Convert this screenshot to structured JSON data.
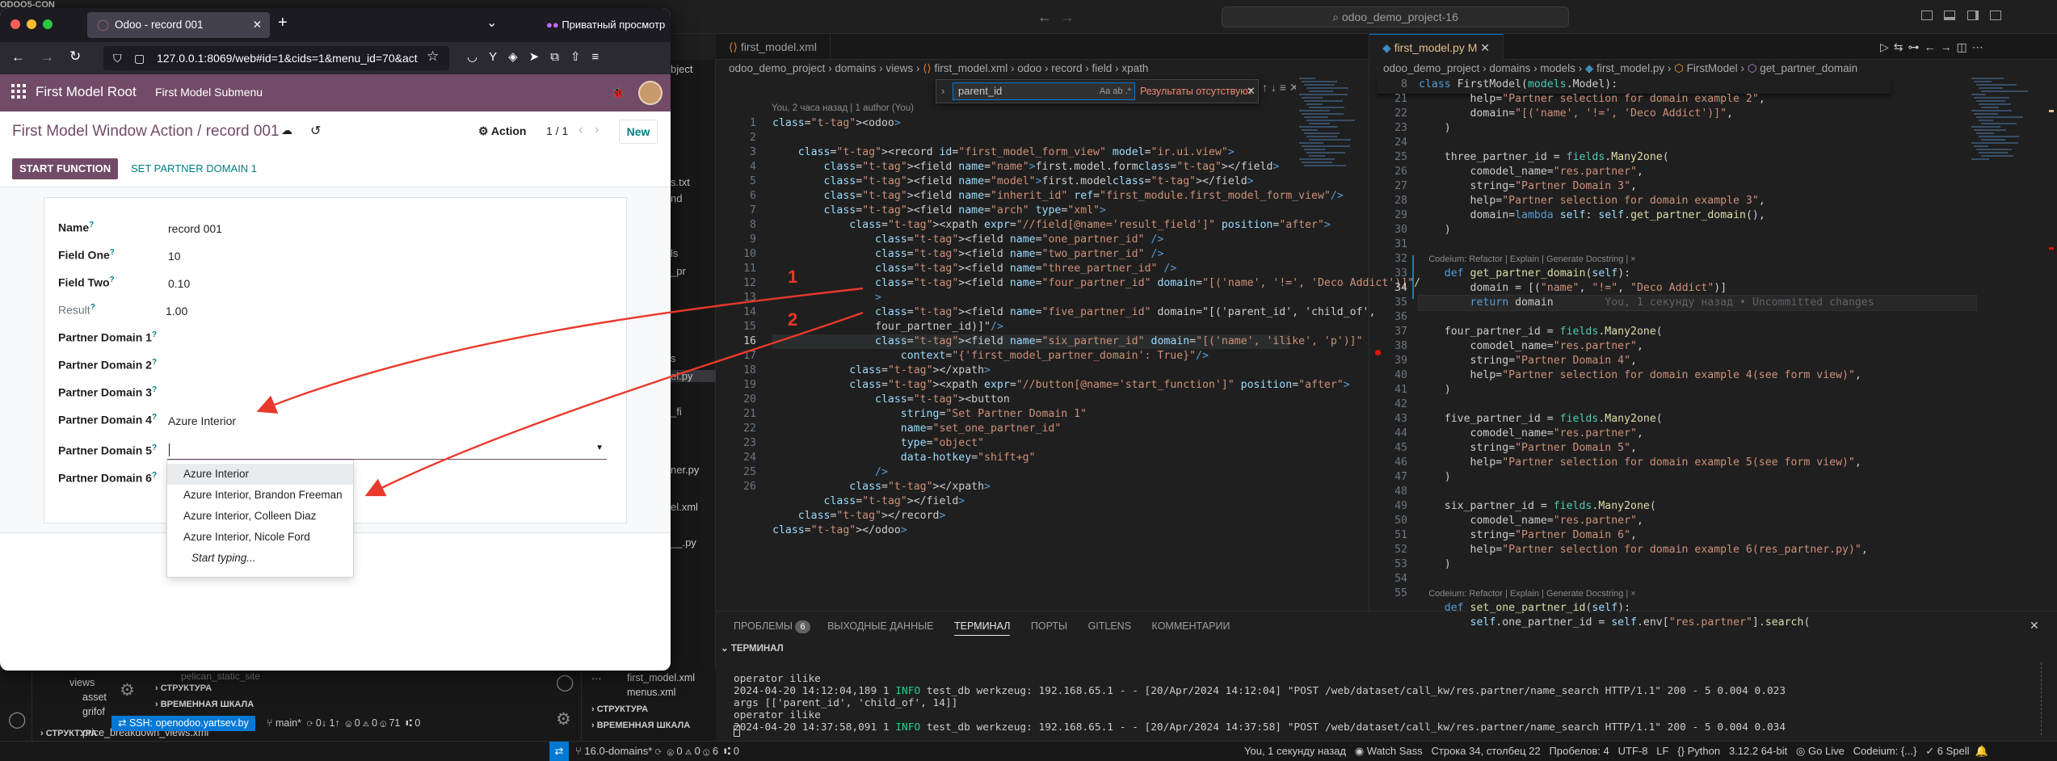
{
  "vscode": {
    "search_text": "odoo_demo_project-16",
    "tabs_left": [
      {
        "label": "first_model.xml",
        "active": false
      }
    ],
    "tabs_right": [
      {
        "label": "first_model.py M",
        "active": true
      }
    ],
    "left_breadcrumb": [
      "odoo_demo_project",
      "domains",
      "views",
      "first_model.xml",
      "odoo",
      "record",
      "field",
      "xpath"
    ],
    "right_breadcrumb": [
      "odoo_demo_project",
      "domains",
      "models",
      "first_model.py",
      "FirstModel",
      "get_partner_domain"
    ],
    "blame": "You, 2 часа назад | 1 author (You)",
    "find_widget": {
      "query": "parent_id",
      "result": "Результаты отсутствуют",
      "options": [
        "Aa",
        "ab",
        ".*"
      ]
    },
    "xml_line_numbers": [
      "1",
      "2",
      "3",
      "4",
      "5",
      "6",
      "7",
      "8",
      "9",
      "10",
      "11",
      "12",
      "",
      "13",
      "",
      "14",
      "",
      "15",
      "16",
      "17",
      "18",
      "19",
      "20",
      "21",
      "22",
      "23",
      "24",
      "25",
      "26"
    ],
    "xml_lines": [
      "<odoo>",
      "",
      "    <record id=\"first_model_form_view\" model=\"ir.ui.view\">",
      "        <field name=\"name\">first.model.form</field>",
      "        <field name=\"model\">first.model</field>",
      "        <field name=\"inherit_id\" ref=\"first_module.first_model_form_view\"/>",
      "        <field name=\"arch\" type=\"xml\">",
      "            <xpath expr=\"//field[@name='result_field']\" position=\"after\">",
      "                <field name=\"one_partner_id\" />",
      "                <field name=\"two_partner_id\" />",
      "                <field name=\"three_partner_id\" />",
      "                <field name=\"four_partner_id\" domain=\"[('name', '!=', 'Deco Addict')]\"/",
      "                >",
      "                <field name=\"five_partner_id\" domain=\"[('parent_id', 'child_of',",
      "                four_partner_id)]\"/>",
      "                <field name=\"six_partner_id\" domain=\"[('name', 'ilike', 'p')]\"",
      "                    context=\"{'first_model_partner_domain': True}\"/>",
      "            </xpath>",
      "            <xpath expr=\"//button[@name='start_function']\" position=\"after\">",
      "                <button",
      "                    string=\"Set Partner Domain 1\"",
      "                    name=\"set_one_partner_id\"",
      "                    type=\"object\"",
      "                    data-hotkey=\"shift+g\"",
      "                />",
      "            </xpath>",
      "        </field>",
      "    </record>",
      "</odoo>"
    ],
    "annotations": [
      "1",
      "2"
    ],
    "py_line_numbers": [
      "8",
      "21",
      "22",
      "23",
      "24",
      "25",
      "26",
      "27",
      "28",
      "29",
      "30",
      "31",
      "",
      "32",
      "33",
      "34",
      "35",
      "36",
      "37",
      "38",
      "39",
      "40",
      "41",
      "42",
      "43",
      "44",
      "45",
      "46",
      "47",
      "48",
      "49",
      "50",
      "51",
      "52",
      "53",
      "",
      "54",
      "55"
    ],
    "py_lines": [
      "class FirstModel(models.Model):",
      "        help=\"Partner selection for domain example 2\",",
      "        domain=\"[('name', '!=', 'Deco Addict')]\",",
      "    )",
      "",
      "    three_partner_id = fields.Many2one(",
      "        comodel_name=\"res.partner\",",
      "        string=\"Partner Domain 3\",",
      "        help=\"Partner selection for domain example 3\",",
      "        domain=lambda self: self.get_partner_domain(),",
      "    )",
      "",
      "    Codeium: Refactor | Explain | Generate Docstring | ×",
      "    def get_partner_domain(self):",
      "        domain = [(\"name\", \"!=\", \"Deco Addict\")]",
      "        return domain        You, 1 секунду назад • Uncommitted changes",
      "",
      "    four_partner_id = fields.Many2one(",
      "        comodel_name=\"res.partner\",",
      "        string=\"Partner Domain 4\",",
      "        help=\"Partner selection for domain example 4(see form view)\",",
      "    )",
      "",
      "    five_partner_id = fields.Many2one(",
      "        comodel_name=\"res.partner\",",
      "        string=\"Partner Domain 5\",",
      "        help=\"Partner selection for domain example 5(see form view)\",",
      "    )",
      "",
      "    six_partner_id = fields.Many2one(",
      "        comodel_name=\"res.partner\",",
      "        string=\"Partner Domain 6\",",
      "        help=\"Partner selection for domain example 6(res_partner.py)\",",
      "    )",
      "",
      "    Codeium: Refactor | Explain | Generate Docstring | ×",
      "    def set_one_partner_id(self):",
      "        self.one_partner_id = self.env[\"res.partner\"].search("
    ],
    "panel_tabs": [
      {
        "label": "ПРОБЛЕМЫ",
        "badge": "6"
      },
      {
        "label": "ВЫХОДНЫЕ ДАННЫЕ"
      },
      {
        "label": "ТЕРМИНАЛ",
        "active": true
      },
      {
        "label": "ПОРТЫ"
      },
      {
        "label": "GITLENS"
      },
      {
        "label": "КОММЕНТАРИИ"
      }
    ],
    "terminal_title": "ТЕРМИНАЛ",
    "terminal_lines": [
      "operator ilike",
      "2024-04-20 14:12:04,189 1 INFO test_db werkzeug: 192.168.65.1 - - [20/Apr/2024 14:12:04] \"POST /web/dataset/call_kw/res.partner/name_search HTTP/1.1\" 200 - 5 0.004 0.023",
      "args [['parent_id', 'child_of', 14]]",
      "operator ilike",
      "2024-04-20 14:37:58,091 1 INFO test_db werkzeug: 192.168.65.1 - - [20/Apr/2024 14:37:58] \"POST /web/dataset/call_kw/res.partner/name_search HTTP/1.1\" 200 - 5 0.004 0.034"
    ],
    "sidebar_fragments": [
      "ODOO5-CON",
      "bject",
      "s.txt",
      "nd",
      "ls",
      "_pr",
      "el.py",
      "_fi",
      "s",
      "__",
      "_.py",
      "el.xml",
      "ner.py",
      "el.xml",
      "__.py"
    ],
    "left_bottom": {
      "views_label": "views",
      "asset": "asset",
      "grifo": "grifof",
      "price": "price_breakdown_views.xml",
      "pelican": "pelican_static_site",
      "struct1": "СТРУКТУРА",
      "timeline": "ВРЕМЕННАЯ ШКАЛА",
      "struct_bottom": "СТРУКТУРА",
      "ssh": "SSH: openodoo.yartsev.by",
      "branch": "main*",
      "sync": "0↓ 1↑",
      "problems": "0 ⚠ 0 ⓘ 71",
      "ports": "0",
      "mid_files": [
        "first_model.xml",
        "menus.xml"
      ],
      "mid_struct": "СТРУКТУРА",
      "mid_timeline": "ВРЕМЕННАЯ ШКАЛА"
    },
    "status_right": {
      "branch": "16.0-domains*",
      "errors": "0",
      "warnings": "0",
      "info": "6",
      "ports": "0",
      "blame": "You, 1 секунду назад",
      "watch": "Watch Sass",
      "position": "Строка 34, столбец 22",
      "spaces": "Пробелов: 4",
      "encoding": "UTF-8",
      "eol": "LF",
      "lang": "Python",
      "version": "3.12.2 64-bit",
      "golive": "Go Live",
      "codeium": "Codeium: {...}",
      "spell": "6 Spell"
    }
  },
  "browser": {
    "tab_title": "Odoo - record 001",
    "private_label": "Приватный просмотр",
    "url": "127.0.0.1:8069/web#id=1&cids=1&menu_id=70&act",
    "app_name": "First Model Root",
    "submenu": "First Model Submenu",
    "breadcrumb": "First Model Window Action / record 001",
    "action_label": "Action",
    "pager": "1 / 1",
    "new_label": "New",
    "start_button": "START FUNCTION",
    "set_domain_button": "SET PARTNER DOMAIN 1",
    "fields": [
      {
        "label": "Name",
        "value": "record 001"
      },
      {
        "label": "Field One",
        "value": "10"
      },
      {
        "label": "Field Two",
        "value": "0.10"
      },
      {
        "label": "Result",
        "value": "1.00"
      },
      {
        "label": "Partner Domain 1",
        "value": ""
      },
      {
        "label": "Partner Domain 2",
        "value": ""
      },
      {
        "label": "Partner Domain 3",
        "value": ""
      },
      {
        "label": "Partner Domain 4",
        "value": "Azure Interior"
      },
      {
        "label": "Partner Domain 5",
        "value": ""
      },
      {
        "label": "Partner Domain 6",
        "value": ""
      }
    ],
    "dropdown": [
      "Azure Interior",
      "Azure Interior, Brandon Freeman",
      "Azure Interior, Colleen Diaz",
      "Azure Interior, Nicole Ford"
    ],
    "dropdown_more": "Start typing...",
    "help_mark": "?"
  },
  "colors": {
    "odoo_primary": "#714b67",
    "odoo_teal": "#017e84",
    "arrow": "#e8392b",
    "vscode_bg": "#1f1f1f"
  }
}
